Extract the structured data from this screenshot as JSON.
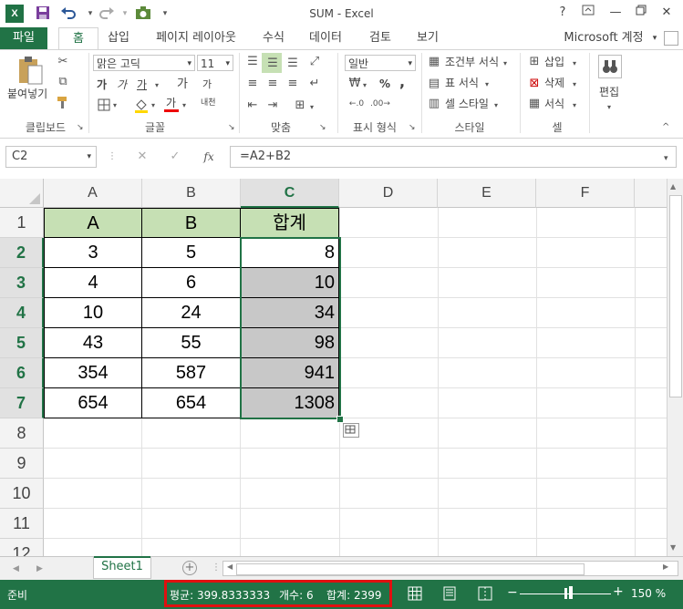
{
  "window": {
    "title": "SUM - Excel",
    "help_label": "?"
  },
  "qat": {
    "logo": "X",
    "save_icon": "save-icon",
    "undo_icon": "undo-icon",
    "redo_icon": "redo-icon"
  },
  "tabs": {
    "file": "파일",
    "items": [
      "홈",
      "삽입",
      "페이지 레이아웃",
      "수식",
      "데이터",
      "검토",
      "보기"
    ],
    "account": "Microsoft 계정"
  },
  "ribbon": {
    "clipboard": {
      "paste": "붙여넣기",
      "label": "클립보드"
    },
    "font": {
      "name": "맑은 고딕",
      "size": "11",
      "label": "글꼴",
      "bold": "가",
      "italic": "가",
      "underline": "가",
      "grow": "가",
      "shrink": "가",
      "color": "가",
      "phonetic": "내천"
    },
    "alignment": {
      "label": "맞춤"
    },
    "number": {
      "format": "일반",
      "label": "표시 형식",
      "percent": "%",
      "comma": ","
    },
    "styles": {
      "conditional": "조건부 서식",
      "table": "표 서식",
      "cell": "셀 스타일",
      "label": "스타일"
    },
    "cells": {
      "insert": "삽입",
      "delete": "삭제",
      "format": "서식",
      "label": "셀"
    },
    "editing": {
      "label": "편집"
    }
  },
  "formula_bar": {
    "name_box": "C2",
    "fx": "fx",
    "formula": "=A2+B2"
  },
  "columns": [
    "A",
    "B",
    "C",
    "D",
    "E",
    "F"
  ],
  "rows": [
    "1",
    "2",
    "3",
    "4",
    "5",
    "6",
    "7",
    "8",
    "9",
    "10",
    "11",
    "12"
  ],
  "table": {
    "headers": [
      "A",
      "B",
      "합계"
    ],
    "data": [
      [
        "3",
        "5",
        "8"
      ],
      [
        "4",
        "6",
        "10"
      ],
      [
        "10",
        "24",
        "34"
      ],
      [
        "43",
        "55",
        "98"
      ],
      [
        "354",
        "587",
        "941"
      ],
      [
        "654",
        "654",
        "1308"
      ]
    ]
  },
  "sheet": {
    "tab": "Sheet1",
    "add_label": "+"
  },
  "status": {
    "ready": "준비",
    "average": "평균: 399.8333333",
    "count": "개수: 6",
    "sum": "합계: 2399",
    "zoom": "150 %"
  },
  "colors": {
    "accent": "#217346",
    "header_fill": "#c6e0b4",
    "selection_fill": "#c8c8c8",
    "highlight_box": "#e01010"
  }
}
